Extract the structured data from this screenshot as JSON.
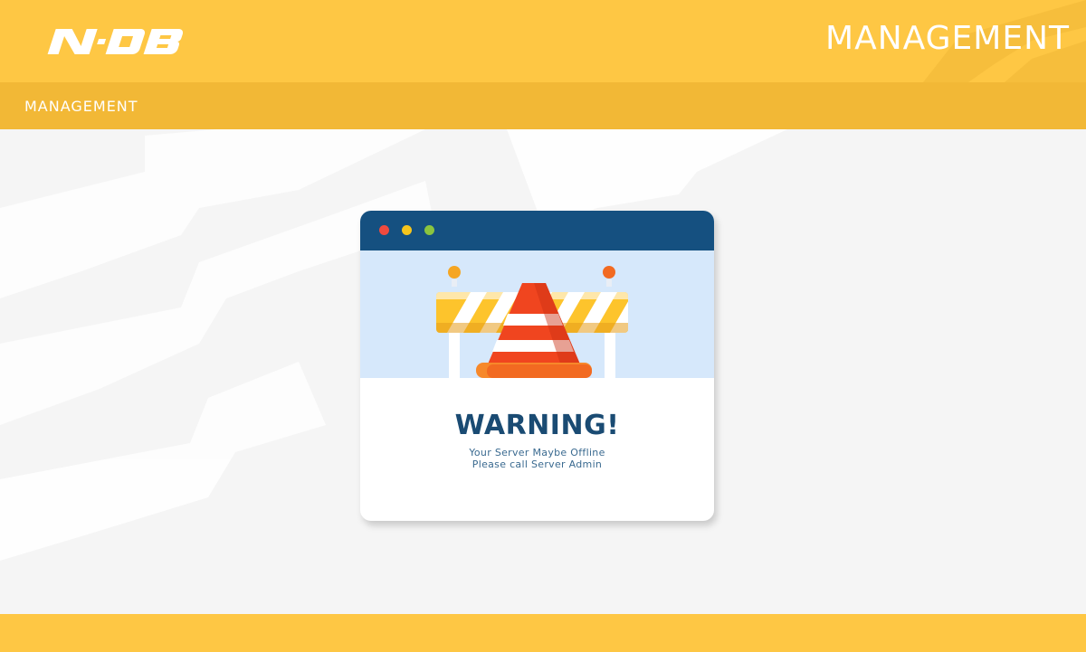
{
  "colors": {
    "header": "#fec744",
    "subbar": "#f2b836",
    "background": "#f5f5f5",
    "card_titlebar": "#155080",
    "card_hero": "#d6e8fb",
    "warning_text": "#1a4b73"
  },
  "header": {
    "logo_text": "NOB",
    "title": "MANAGEMENT"
  },
  "subbar": {
    "label": "MANAGEMENT"
  },
  "warning_card": {
    "window_dots": [
      "red-dot",
      "yellow-dot",
      "green-dot"
    ],
    "illustration": "traffic-cone-barrier-icon",
    "title": "WARNING!",
    "line1": "Your Server Maybe Offline",
    "line2": "Please call Server Admin"
  }
}
